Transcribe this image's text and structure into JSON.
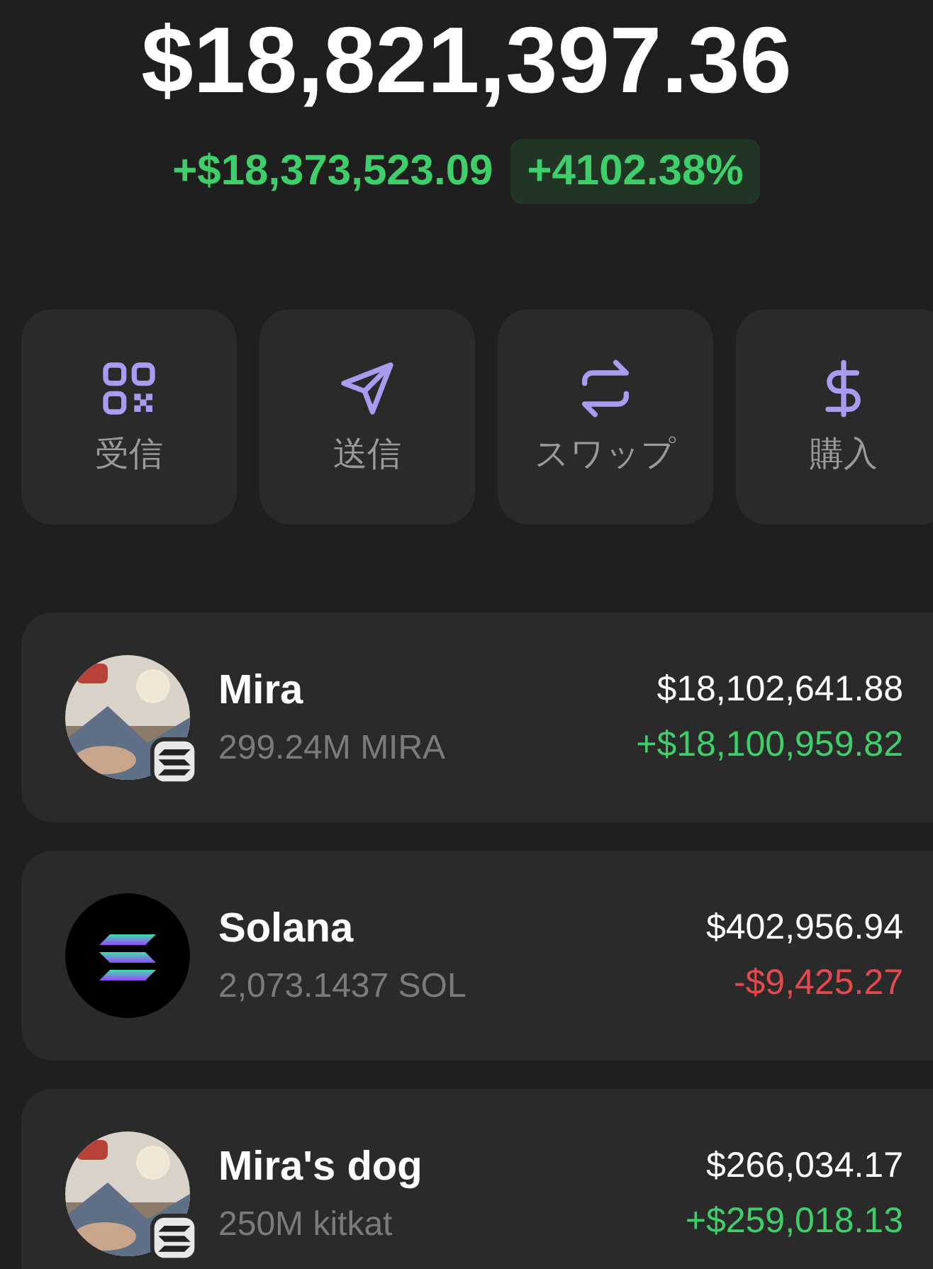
{
  "balance": {
    "total": "$18,821,397.36",
    "change_amount": "+$18,373,523.09",
    "change_percent": "+4102.38%"
  },
  "actions": [
    {
      "label": "受信"
    },
    {
      "label": "送信"
    },
    {
      "label": "スワップ"
    },
    {
      "label": "購入"
    }
  ],
  "tokens": [
    {
      "name": "Mira",
      "amount": "299.24M MIRA",
      "value": "$18,102,641.88",
      "change": "+$18,100,959.82",
      "color": "#3ecf6a",
      "kind": "picture",
      "chain_badge": true
    },
    {
      "name": "Solana",
      "amount": "2,073.1437 SOL",
      "value": "$402,956.94",
      "change": "-$9,425.27",
      "color": "#e5484d",
      "kind": "logo",
      "chain_badge": false
    },
    {
      "name": "Mira's dog",
      "amount": "250M kitkat",
      "value": "$266,034.17",
      "change": "+$259,018.13",
      "color": "#3ecf6a",
      "kind": "picture",
      "chain_badge": true
    }
  ]
}
